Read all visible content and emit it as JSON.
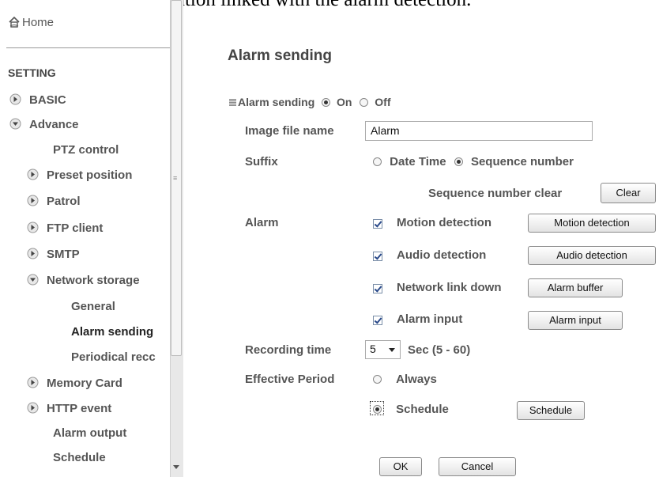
{
  "caption": "to network storage location linked with the alarm detection.",
  "sidebar": {
    "home": "Home",
    "setting": "SETTING",
    "items": [
      {
        "label": "BASIC"
      },
      {
        "label": "Advance"
      },
      {
        "label": "PTZ control"
      },
      {
        "label": "Preset position"
      },
      {
        "label": "Patrol"
      },
      {
        "label": "FTP client"
      },
      {
        "label": "SMTP"
      },
      {
        "label": "Network storage"
      },
      {
        "label": "General"
      },
      {
        "label": "Alarm sending"
      },
      {
        "label": "Periodical recc"
      },
      {
        "label": "Memory Card"
      },
      {
        "label": "HTTP event"
      },
      {
        "label": "Alarm output"
      },
      {
        "label": "Schedule"
      }
    ]
  },
  "main": {
    "title": "Alarm sending",
    "alarm_sending": {
      "label": "Alarm sending",
      "on": "On",
      "off": "Off",
      "selected": "On"
    },
    "image_file_name": {
      "label": "Image file name",
      "value": "Alarm"
    },
    "suffix": {
      "label": "Suffix",
      "date_time": "Date Time",
      "sequence_number": "Sequence number",
      "selected": "Sequence number"
    },
    "sequence_clear": {
      "label": "Sequence number clear",
      "button": "Clear"
    },
    "alarm": {
      "label": "Alarm",
      "rows": [
        {
          "label": "Motion detection",
          "checked": true,
          "button": "Motion detection"
        },
        {
          "label": "Audio detection",
          "checked": true,
          "button": "Audio detection"
        },
        {
          "label": "Network link down",
          "checked": true,
          "button": "Alarm buffer"
        },
        {
          "label": "Alarm input",
          "checked": true,
          "button": "Alarm input"
        }
      ]
    },
    "recording_time": {
      "label": "Recording time",
      "value": "5",
      "unit": "Sec (5 - 60)"
    },
    "effective_period": {
      "label": "Effective Period",
      "always": "Always",
      "schedule": "Schedule",
      "selected": "Schedule",
      "button": "Schedule"
    },
    "ok": "OK",
    "cancel": "Cancel"
  }
}
